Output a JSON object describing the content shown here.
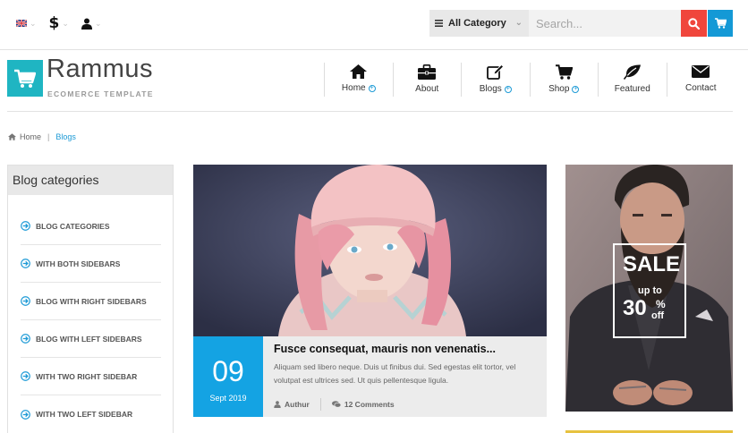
{
  "topbar": {
    "language_icon": "uk-flag-icon",
    "currency_symbol": "$",
    "account_icon": "user-icon",
    "category_label": "All Category",
    "search_placeholder": "Search...",
    "search_icon": "search-icon",
    "cart_icon": "cart-icon",
    "search_color": "#f0463c",
    "cart_color": "#1499d6"
  },
  "header": {
    "logo_name": "Rammus",
    "logo_tagline": "ECOMERCE TEMPLATE",
    "logo_color": "#1fb5c2"
  },
  "nav": {
    "items": [
      {
        "label": "Home",
        "icon": "home-icon",
        "has_submenu": true
      },
      {
        "label": "About",
        "icon": "briefcase-icon",
        "has_submenu": false
      },
      {
        "label": "Blogs",
        "icon": "edit-icon",
        "has_submenu": true
      },
      {
        "label": "Shop",
        "icon": "cart-icon",
        "has_submenu": true
      },
      {
        "label": "Featured",
        "icon": "leaf-icon",
        "has_submenu": false
      },
      {
        "label": "Contact",
        "icon": "envelope-icon",
        "has_submenu": false
      }
    ]
  },
  "breadcrumb": {
    "home": "Home",
    "separator": "|",
    "current": "Blogs"
  },
  "sidebar": {
    "title": "Blog categories",
    "items": [
      "BLOG CATEGORIES",
      "WITH BOTH SIDEBARS",
      "BLOG WITH RIGHT SIDEBARS",
      "BLOG WITH LEFT SIDEBARS",
      "WITH TWO RIGHT SIDEBAR",
      "WITH TWO LEFT SIDEBAR"
    ]
  },
  "post": {
    "day": "09",
    "month_year": "Sept 2019",
    "title": "Fusce consequat, mauris non venenatis...",
    "excerpt": "Aliquam sed libero neque. Duis ut finibus dui. Sed egestas elit tortor, vel volutpat est ultrices sed. Ut quis pellentesque ligula.",
    "author": "Authur",
    "comments": "12 Comments",
    "date_color": "#14a3e3"
  },
  "banner": {
    "sale": "SALE",
    "up_to": "up to",
    "amount": "30",
    "percent": "%",
    "off": "off"
  }
}
